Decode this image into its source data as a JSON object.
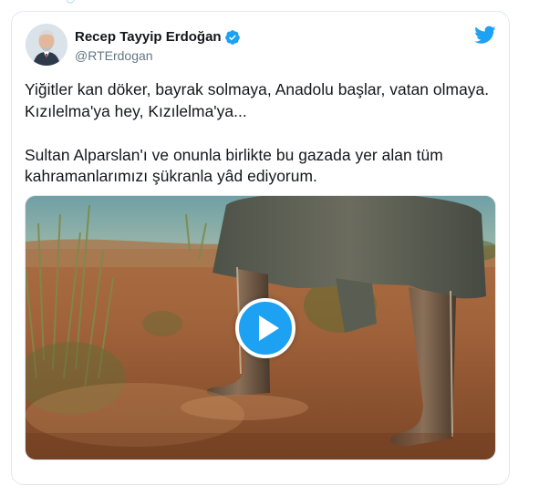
{
  "tweet": {
    "author": {
      "display_name": "Recep Tayyip Erdoğan",
      "handle": "@RTErdogan",
      "verified": true
    },
    "paragraphs": [
      "Yiğitler kan döker, bayrak solmaya, Anadolu başlar, vatan olmaya. Kızılelma'ya hey, Kızılelma'ya...",
      "Sultan Alparslan'ı ve onunla birlikte bu gazada yer alan tüm kahramanlarımızı şükranla yâd ediyorum."
    ],
    "media": {
      "type": "video",
      "play_icon": "play-icon"
    }
  },
  "icons": {
    "verified": "verified-badge-icon",
    "platform": "twitter-bird-icon"
  },
  "colors": {
    "accent": "#1da1f2",
    "text": "#14171a",
    "secondary_text": "#657786",
    "border": "#e1e8ed"
  }
}
